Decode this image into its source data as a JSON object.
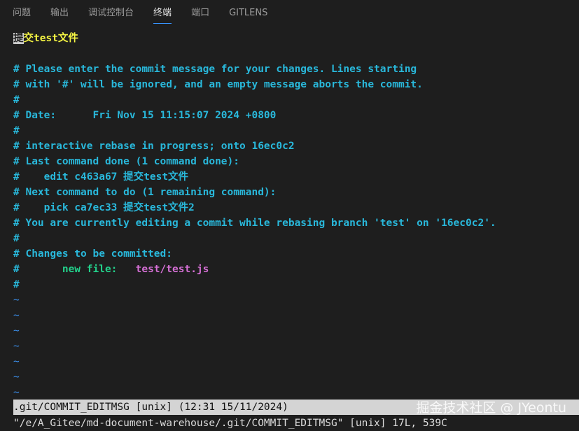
{
  "panel_tabs": [
    {
      "label": "问题"
    },
    {
      "label": "输出"
    },
    {
      "label": "调试控制台"
    },
    {
      "label": "终端",
      "active": true
    },
    {
      "label": "端口"
    },
    {
      "label": "GITLENS"
    }
  ],
  "editor": {
    "first_line": {
      "cursor_char": "提",
      "rest": "交test文件"
    },
    "lines": [
      "",
      "# Please enter the commit message for your changes. Lines starting",
      "# with '#' will be ignored, and an empty message aborts the commit.",
      "#",
      "# Date:      Fri Nov 15 11:15:07 2024 +0800",
      "#",
      "# interactive rebase in progress; onto 16ec0c2",
      "# Last command done (1 command done):",
      "#    edit c463a67 提交test文件",
      "# Next command to do (1 remaining command):",
      "#    pick ca7ec33 提交test文件2",
      "# You are currently editing a commit while rebasing branch 'test' on '16ec0c2'.",
      "#",
      "# Changes to be committed:"
    ],
    "changes_line": {
      "prefix": "#       ",
      "status": "new file:",
      "gap": "   ",
      "path": "test/test.js"
    },
    "after_lines": [
      "#"
    ],
    "tildes": [
      "~",
      "~",
      "~",
      "~",
      "~",
      "~",
      "~"
    ]
  },
  "status_line": ".git/COMMIT_EDITMSG [unix] (12:31 15/11/2024)",
  "message_line": "\"/e/A_Gitee/md-document-warehouse/.git/COMMIT_EDITMSG\" [unix] 17L, 539C",
  "watermark": "掘金技术社区 @ JYeontu",
  "colors": {
    "background": "#1e1e1e",
    "comment": "#29b8db",
    "first_line": "#f5f543",
    "new_file_label": "#23d18b",
    "new_file_path": "#d670d6",
    "tilde": "#3b8eea",
    "status_bar": "#d4d4d4"
  }
}
